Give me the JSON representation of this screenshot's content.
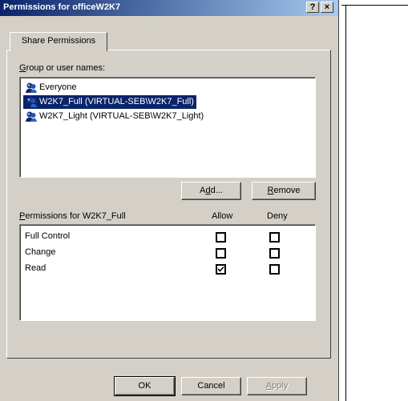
{
  "window": {
    "title": "Permissions for officeW2K7",
    "help_button": "?",
    "close_button": "×"
  },
  "tab": {
    "label": "Share Permissions"
  },
  "groups": {
    "label_prefix": "",
    "label_accel": "G",
    "label_rest": "roup or user names:",
    "items": [
      {
        "name": "Everyone",
        "selected": false
      },
      {
        "name": "W2K7_Full (VIRTUAL-SEB\\W2K7_Full)",
        "selected": true
      },
      {
        "name": "W2K7_Light (VIRTUAL-SEB\\W2K7_Light)",
        "selected": false
      }
    ],
    "add_prefix": "A",
    "add_accel": "d",
    "add_rest": "d...",
    "remove_accel": "R",
    "remove_rest": "emove"
  },
  "permissions": {
    "label_accel": "P",
    "label_rest": "ermissions for W2K7_Full",
    "allow_header": "Allow",
    "deny_header": "Deny",
    "rows": [
      {
        "name": "Full Control",
        "allow": false,
        "deny": false
      },
      {
        "name": "Change",
        "allow": false,
        "deny": false
      },
      {
        "name": "Read",
        "allow": true,
        "deny": false
      }
    ]
  },
  "footer": {
    "ok_label": "OK",
    "cancel_label": "Cancel",
    "apply_accel": "A",
    "apply_rest": "pply"
  }
}
